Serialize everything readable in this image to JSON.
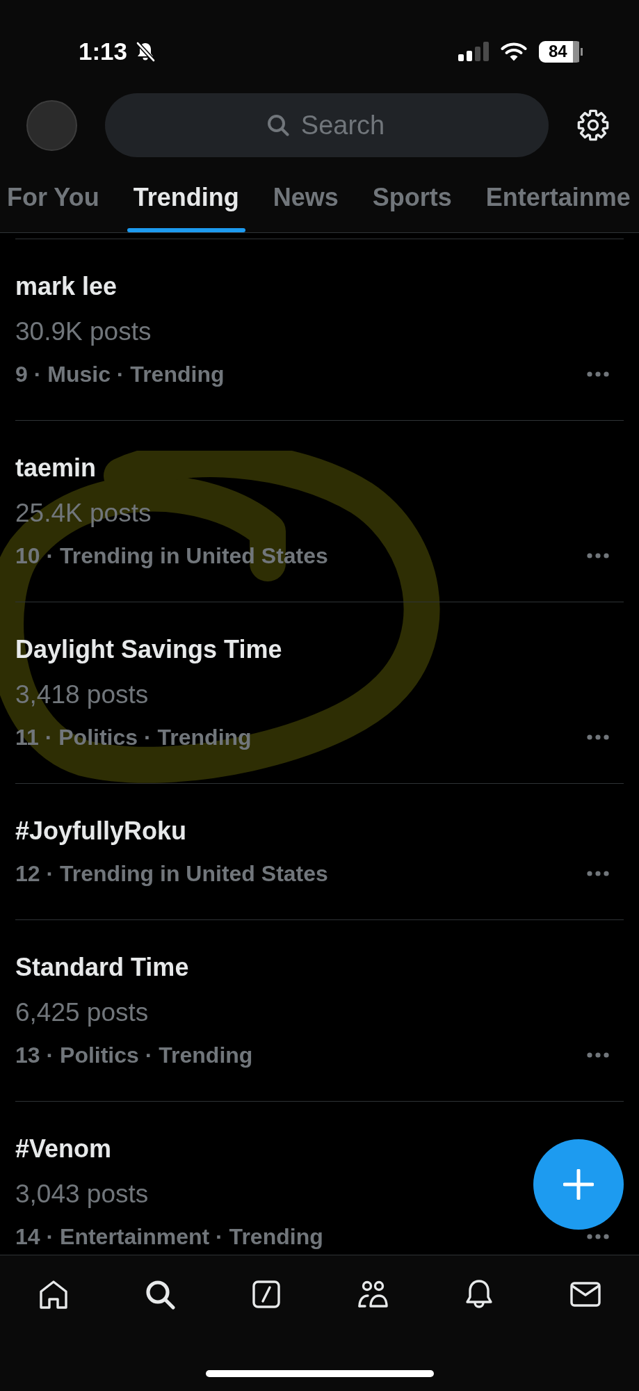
{
  "status_bar": {
    "time": "1:13",
    "silent": true,
    "battery": "84"
  },
  "search": {
    "placeholder": "Search"
  },
  "tabs": [
    {
      "label": "For You",
      "selected": false
    },
    {
      "label": "Trending",
      "selected": true
    },
    {
      "label": "News",
      "selected": false
    },
    {
      "label": "Sports",
      "selected": false
    },
    {
      "label": "Entertainme",
      "selected": false
    }
  ],
  "trends": [
    {
      "title": "mark lee",
      "posts": "30.9K posts",
      "meta": "9 · Music · Trending"
    },
    {
      "title": "taemin",
      "posts": "25.4K posts",
      "meta": "10 · Trending in United States"
    },
    {
      "title": "Daylight Savings Time",
      "posts": "3,418 posts",
      "meta": "11 · Politics · Trending"
    },
    {
      "title": "#JoyfullyRoku",
      "meta": "12 · Trending in United States"
    },
    {
      "title": "Standard Time",
      "posts": "6,425 posts",
      "meta": "13 · Politics · Trending"
    },
    {
      "title": "#Venom",
      "posts": "3,043 posts",
      "meta": "14 · Entertainment · Trending"
    }
  ],
  "annotation": {
    "kind": "marker-loop"
  },
  "nav": [
    {
      "kind": "home",
      "selected": false
    },
    {
      "kind": "search",
      "selected": true
    },
    {
      "kind": "square-slash",
      "selected": false
    },
    {
      "kind": "people",
      "selected": false
    },
    {
      "kind": "bell",
      "selected": false
    },
    {
      "kind": "mail",
      "selected": false
    }
  ]
}
